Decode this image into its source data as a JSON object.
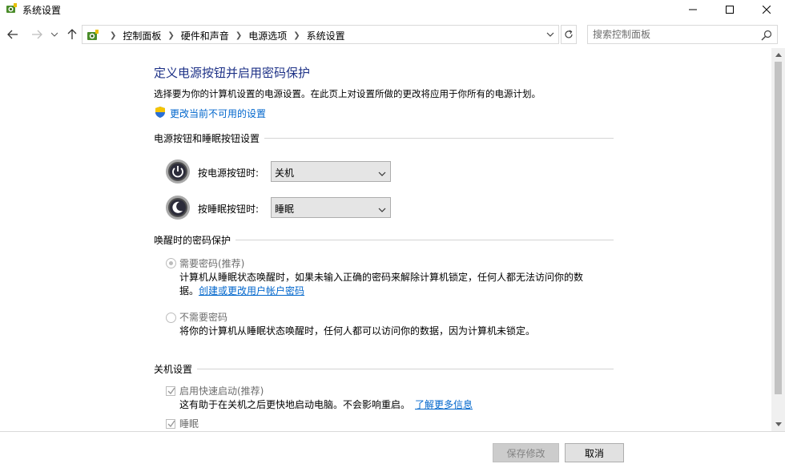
{
  "window": {
    "title": "系统设置"
  },
  "addressbar": {
    "crumbs": [
      "控制面板",
      "硬件和声音",
      "电源选项",
      "系统设置"
    ],
    "search_placeholder": "搜索控制面板"
  },
  "page": {
    "title": "定义电源按钮并启用密码保护",
    "description": "选择要为你的计算机设置的电源设置。在此页上对设置所做的更改将应用于你所有的电源计划。",
    "change_link": "更改当前不可用的设置"
  },
  "power_section": {
    "label": "电源按钮和睡眠按钮设置",
    "power_button_label": "按电源按钮时:",
    "power_button_value": "关机",
    "sleep_button_label": "按睡眠按钮时:",
    "sleep_button_value": "睡眠"
  },
  "password_section": {
    "label": "唤醒时的密码保护",
    "require_label": "需要密码(推荐)",
    "require_desc": "计算机从睡眠状态唤醒时，如果未输入正确的密码来解除计算机锁定，任何人都无法访问你的数",
    "require_desc_cont": "据。",
    "require_link": "创建或更改用户帐户密码",
    "require_checked": true,
    "norequire_label": "不需要密码",
    "norequire_desc": "将你的计算机从睡眠状态唤醒时，任何人都可以访问你的数据，因为计算机未锁定。",
    "norequire_checked": false
  },
  "shutdown_section": {
    "label": "关机设置",
    "fast_startup_label": "启用快速启动(推荐)",
    "fast_startup_checked": true,
    "fast_startup_desc": "这有助于在关机之后更快地启动电脑。不会影响重启。",
    "fast_startup_link": "了解更多信息",
    "sleep_label": "睡眠",
    "sleep_checked": true
  },
  "footer": {
    "save_label": "保存修改",
    "cancel_label": "取消"
  },
  "colors": {
    "title_blue": "#1e3287",
    "link_blue": "#0066cc",
    "disabled_text": "#6d6d6d"
  }
}
